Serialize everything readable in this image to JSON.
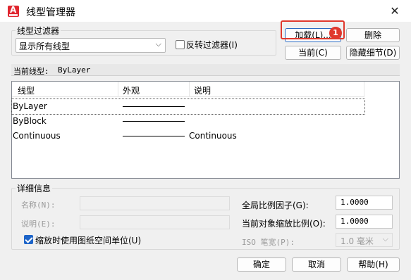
{
  "window": {
    "title": "线型管理器",
    "app_icon_letter": "A",
    "close_glyph": "✕"
  },
  "filter": {
    "group_label": "线型过滤器",
    "selected": "显示所有线型",
    "invert_label": "反转过滤器(I)",
    "invert_checked": false
  },
  "buttons": {
    "load": "加载(L)...",
    "delete": "删除",
    "current": "当前(C)",
    "hide_details": "隐藏细节(D)",
    "ok": "确定",
    "cancel": "取消",
    "help": "帮助(H)"
  },
  "current_linetype": {
    "label": "当前线型:",
    "value": "ByLayer"
  },
  "table": {
    "columns": [
      "线型",
      "外观",
      "说明"
    ],
    "rows": [
      {
        "name": "ByLayer",
        "description": "",
        "selected": true
      },
      {
        "name": "ByBlock",
        "description": "",
        "selected": false
      },
      {
        "name": "Continuous",
        "description": "Continuous",
        "selected": false
      }
    ]
  },
  "details": {
    "group_label": "详细信息",
    "name_label": "名称(N):",
    "desc_label": "说明(E):",
    "paper_space_label": "缩放时使用图纸空间单位(U)",
    "paper_space_checked": true,
    "global_scale_label": "全局比例因子(G):",
    "global_scale_value": "1.0000",
    "current_scale_label": "当前对象缩放比例(O):",
    "current_scale_value": "1.0000",
    "iso_pen_label": "ISO 笔宽(P):",
    "iso_pen_value": "1.0 毫米"
  },
  "annotation": {
    "badge_number": "1",
    "highlight_color": "#e0382d"
  },
  "colors": {
    "accent": "#1d64c8",
    "badge": "#e0382d"
  }
}
